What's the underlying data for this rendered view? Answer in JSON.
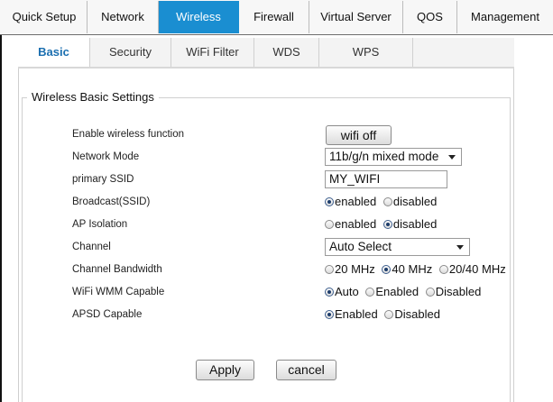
{
  "top_tabs": [
    {
      "label": "Quick Setup",
      "active": false
    },
    {
      "label": "Network",
      "active": false
    },
    {
      "label": "Wireless",
      "active": true
    },
    {
      "label": "Firewall",
      "active": false
    },
    {
      "label": "Virtual Server",
      "active": false
    },
    {
      "label": "QOS",
      "active": false
    },
    {
      "label": "Management",
      "active": false
    }
  ],
  "sub_tabs": [
    {
      "label": "Basic",
      "active": true
    },
    {
      "label": "Security",
      "active": false
    },
    {
      "label": "WiFi Filter",
      "active": false
    },
    {
      "label": "WDS",
      "active": false
    },
    {
      "label": "WPS",
      "active": false
    }
  ],
  "section_title": "Wireless Basic Settings",
  "fields": {
    "enable_wireless": {
      "label": "Enable wireless function",
      "button": "wifi off"
    },
    "network_mode": {
      "label": "Network Mode",
      "value": "11b/g/n mixed mode"
    },
    "primary_ssid": {
      "label": "primary SSID",
      "value": "MY_WIFI"
    },
    "broadcast": {
      "label": "Broadcast(SSID)",
      "options": [
        "enabled",
        "disabled"
      ],
      "selected": "enabled"
    },
    "ap_isolation": {
      "label": "AP Isolation",
      "options": [
        "enabled",
        "disabled"
      ],
      "selected": "disabled"
    },
    "channel": {
      "label": "Channel",
      "value": "Auto Select"
    },
    "channel_bandwidth": {
      "label": "Channel Bandwidth",
      "options": [
        "20 MHz",
        "40 MHz",
        "20/40 MHz"
      ],
      "selected": "40 MHz"
    },
    "wmm": {
      "label": "WiFi WMM Capable",
      "options": [
        "Auto",
        "Enabled",
        "Disabled"
      ],
      "selected": "Auto"
    },
    "apsd": {
      "label": "APSD Capable",
      "options": [
        "Enabled",
        "Disabled"
      ],
      "selected": "Enabled"
    }
  },
  "buttons": {
    "apply": "Apply",
    "cancel": "cancel"
  },
  "colors": {
    "accent": "#1a8ed1",
    "active_subtab_text": "#1b6fb0"
  }
}
